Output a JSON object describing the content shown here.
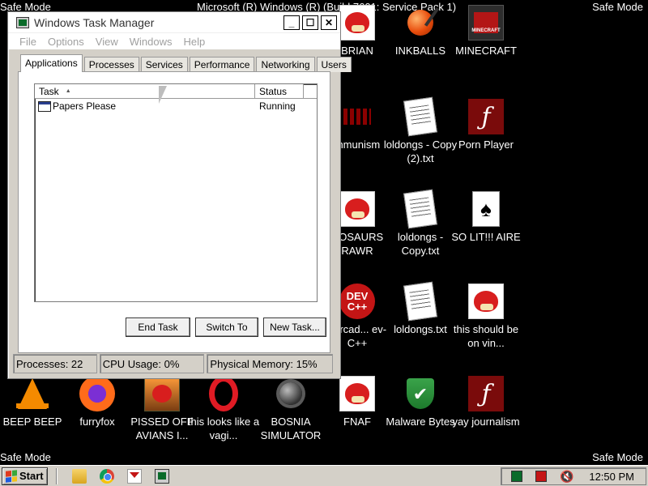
{
  "overlay": {
    "safe_mode": "Safe Mode",
    "os_title": "Microsoft (R) Windows (R) (Build 7601: Service Pack 1)"
  },
  "desktop": {
    "icons": [
      {
        "label": "BRIAN",
        "icon": "angry-bird-icon"
      },
      {
        "label": "INKBALLS",
        "icon": "inkball-icon"
      },
      {
        "label": "MINECRAFT",
        "icon": "minecraft-icon"
      },
      {
        "label": "mmunism",
        "icon": "communism-icon"
      },
      {
        "label": "loldongs - Copy (2).txt",
        "icon": "text-file-icon"
      },
      {
        "label": "Porn Player",
        "icon": "flash-icon"
      },
      {
        "label": "NOSAURS RAWR",
        "icon": "angry-bird-icon"
      },
      {
        "label": "loldongs - Copy.txt",
        "icon": "text-file-icon"
      },
      {
        "label": "SO LIT!!! AIRE",
        "icon": "solitaire-icon"
      },
      {
        "label": "barcad... ev-C++",
        "icon": "dev-cpp-icon"
      },
      {
        "label": "loldongs.txt",
        "icon": "text-file-icon"
      },
      {
        "label": "this should be on vin...",
        "icon": "angry-bird-icon"
      },
      {
        "label": "BEEP BEEP",
        "icon": "vlc-icon"
      },
      {
        "label": "furryfox",
        "icon": "firefox-icon"
      },
      {
        "label": "PISSED OFF AVIANS I...",
        "icon": "angry-birds-seasons-icon"
      },
      {
        "label": "this looks like a vagi...",
        "icon": "opera-icon"
      },
      {
        "label": "BOSNIA SIMULATOR",
        "icon": "minesweeper-icon"
      },
      {
        "label": "FNAF",
        "icon": "angry-bird-icon"
      },
      {
        "label": "Malware Bytes",
        "icon": "shield-icon"
      },
      {
        "label": "yay journalism",
        "icon": "flash-icon"
      }
    ]
  },
  "task_manager": {
    "title": "Windows Task Manager",
    "controls": {
      "minimize": "_",
      "maximize": "☐",
      "close": "✕"
    },
    "menu": [
      "File",
      "Options",
      "View",
      "Windows",
      "Help"
    ],
    "tabs": [
      "Applications",
      "Processes",
      "Services",
      "Performance",
      "Networking",
      "Users"
    ],
    "active_tab": "Applications",
    "columns": {
      "task": "Task",
      "status": "Status"
    },
    "rows": [
      {
        "task": "Papers Please",
        "status": "Running"
      }
    ],
    "buttons": {
      "end_task": "End Task",
      "switch_to": "Switch To",
      "new_task": "New Task..."
    },
    "status": {
      "processes": "Processes: 22",
      "cpu": "CPU Usage: 0%",
      "memory": "Physical Memory: 15%"
    }
  },
  "taskbar": {
    "start": "Start",
    "clock": "12:50 PM"
  }
}
